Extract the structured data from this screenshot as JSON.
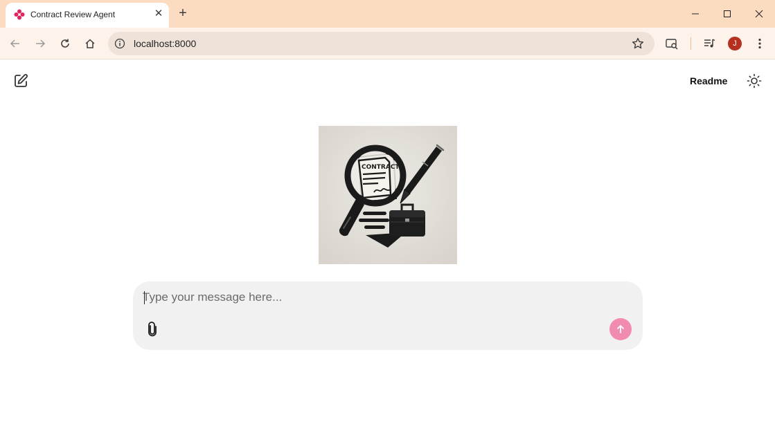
{
  "browser": {
    "tab_title": "Contract Review Agent",
    "url": "localhost:8000",
    "profile_initial": "J",
    "accent_color": "#fcdcc0",
    "favicon_color": "#e0245e"
  },
  "header": {
    "readme_label": "Readme"
  },
  "hero_image": {
    "icon": "contract-magnifier-pen-briefcase-illustration",
    "text": "CONTRACT"
  },
  "composer": {
    "placeholder": "Type your message here...",
    "value": "",
    "send_color": "#f28bb0"
  }
}
